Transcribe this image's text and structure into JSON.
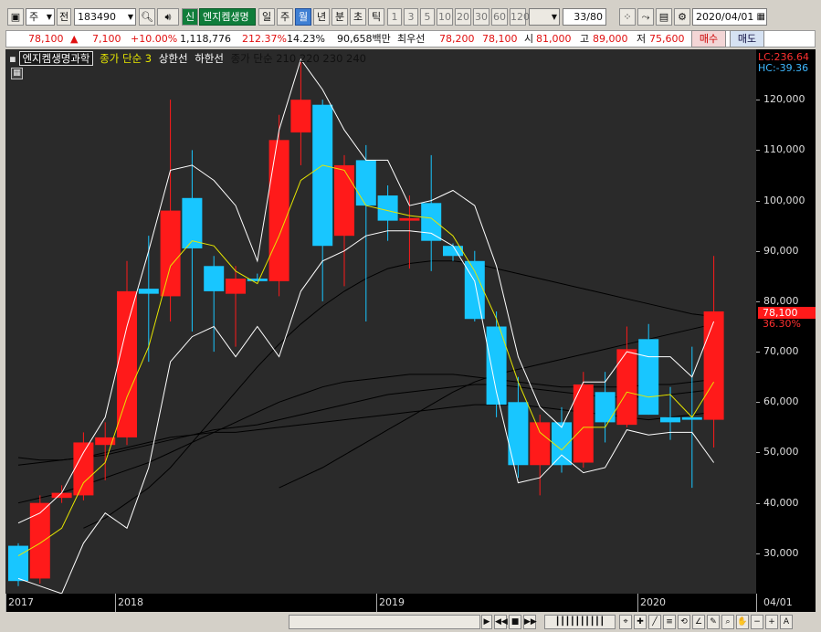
{
  "toolbar": {
    "period_select": "주",
    "prefix_label": "전",
    "code": "183490",
    "market_badge": "신",
    "company": "엔지켐생명",
    "periods": [
      "일",
      "주",
      "월",
      "년"
    ],
    "selected_period": "월",
    "intraday": [
      "분",
      "초",
      "틱"
    ],
    "intervals": [
      "1",
      "3",
      "5",
      "10",
      "20",
      "30",
      "60",
      "120"
    ],
    "counter": "33/80",
    "date": "2020/04/01"
  },
  "quote": {
    "price": "78,100",
    "change": "7,100",
    "change_pct": "+10.00%",
    "volume": "1,118,776",
    "vol_ratio": "212.37%",
    "turnover": "14.23%",
    "amount": "90,658백만",
    "best_label": "최우선",
    "ask": "78,200",
    "bid": "78,100",
    "open_label": "시",
    "open": "81,000",
    "high_label": "고",
    "high": "89,000",
    "low_label": "저",
    "low": "75,600",
    "buy_label": "매수",
    "sell_label": "매도"
  },
  "legend": {
    "name": "엔지켐생명과학",
    "ma_label": "종가 단순 3",
    "upper": "상한선",
    "lower": "하한선",
    "ma_label2": "종가 단순 210  220  230  240"
  },
  "readouts": {
    "lc": "LC:236.64",
    "hc": "HC:-39.36",
    "price_tag": "78,100",
    "pct_tag": "36.30%"
  },
  "colors": {
    "up": "#ff1a1a",
    "down": "#18c6ff",
    "ma": "#e6e600",
    "band": "#ffffff",
    "long_ma": "#000000"
  },
  "chart_data": {
    "type": "candlestick",
    "ylim": [
      22000,
      130000
    ],
    "yticks": [
      "30,000",
      "40,000",
      "50,000",
      "60,000",
      "70,000",
      "80,000",
      "90,000",
      "100,000",
      "110,000",
      "120,000"
    ],
    "x_labels": [
      "2017",
      "2018",
      "2019",
      "2020",
      "04/01"
    ],
    "candles": [
      {
        "o": 31500,
        "h": 32000,
        "l": 23500,
        "c": 24500
      },
      {
        "o": 25000,
        "h": 41500,
        "l": 24000,
        "c": 40000
      },
      {
        "o": 41000,
        "h": 43500,
        "l": 40000,
        "c": 42000
      },
      {
        "o": 41500,
        "h": 54000,
        "l": 40500,
        "c": 52000
      },
      {
        "o": 51500,
        "h": 56000,
        "l": 44500,
        "c": 53000
      },
      {
        "o": 53000,
        "h": 88000,
        "l": 51500,
        "c": 82000
      },
      {
        "o": 82500,
        "h": 93000,
        "l": 68000,
        "c": 81500
      },
      {
        "o": 81000,
        "h": 120000,
        "l": 76000,
        "c": 98000
      },
      {
        "o": 100500,
        "h": 110000,
        "l": 74000,
        "c": 90500
      },
      {
        "o": 87000,
        "h": 89000,
        "l": 70000,
        "c": 82000
      },
      {
        "o": 81500,
        "h": 87000,
        "l": 71000,
        "c": 84500
      },
      {
        "o": 84500,
        "h": 85500,
        "l": 84000,
        "c": 84000
      },
      {
        "o": 84000,
        "h": 117000,
        "l": 81000,
        "c": 112000
      },
      {
        "o": 113500,
        "h": 128000,
        "l": 107000,
        "c": 120000
      },
      {
        "o": 119000,
        "h": 120000,
        "l": 80000,
        "c": 91000
      },
      {
        "o": 93000,
        "h": 109000,
        "l": 83000,
        "c": 107000
      },
      {
        "o": 108000,
        "h": 111000,
        "l": 76000,
        "c": 99000
      },
      {
        "o": 101000,
        "h": 103000,
        "l": 92000,
        "c": 96000
      },
      {
        "o": 96000,
        "h": 101000,
        "l": 86500,
        "c": 96500
      },
      {
        "o": 99500,
        "h": 109000,
        "l": 86000,
        "c": 92000
      },
      {
        "o": 91000,
        "h": 91500,
        "l": 88000,
        "c": 89000
      },
      {
        "o": 88000,
        "h": 90000,
        "l": 76000,
        "c": 76500
      },
      {
        "o": 75000,
        "h": 78000,
        "l": 57000,
        "c": 59500
      },
      {
        "o": 60000,
        "h": 65000,
        "l": 45000,
        "c": 47500
      },
      {
        "o": 47500,
        "h": 57500,
        "l": 41500,
        "c": 56000
      },
      {
        "o": 56000,
        "h": 59000,
        "l": 46000,
        "c": 47500
      },
      {
        "o": 48000,
        "h": 66000,
        "l": 47000,
        "c": 63500
      },
      {
        "o": 62000,
        "h": 66000,
        "l": 52000,
        "c": 56000
      },
      {
        "o": 55500,
        "h": 75000,
        "l": 55000,
        "c": 70500
      },
      {
        "o": 72500,
        "h": 75500,
        "l": 57500,
        "c": 57500
      },
      {
        "o": 57000,
        "h": 63000,
        "l": 52500,
        "c": 56000
      },
      {
        "o": 57000,
        "h": 71000,
        "l": 43000,
        "c": 56500
      },
      {
        "o": 56500,
        "h": 89000,
        "l": 51000,
        "c": 78000
      }
    ],
    "ma3": [
      29500,
      32000,
      35000,
      44000,
      48000,
      61000,
      71000,
      87000,
      92000,
      91000,
      86000,
      83500,
      93000,
      104000,
      107000,
      106000,
      99000,
      98000,
      97000,
      96500,
      93000,
      86000,
      76500,
      64000,
      54000,
      50500,
      55000,
      55000,
      62000,
      61000,
      61500,
      57000,
      64000
    ],
    "band_upper": [
      36000,
      38000,
      42000,
      50000,
      57000,
      75000,
      90000,
      106000,
      107000,
      104000,
      99000,
      88000,
      114000,
      128000,
      122000,
      114000,
      108000,
      108000,
      99000,
      100000,
      102000,
      99000,
      87000,
      69000,
      59000,
      55000,
      64000,
      64000,
      70000,
      69000,
      69000,
      65000,
      76000
    ],
    "band_lower": [
      25000,
      23500,
      22000,
      32000,
      38000,
      35000,
      47000,
      68000,
      73000,
      75000,
      69000,
      75000,
      69000,
      82000,
      88000,
      90000,
      93000,
      94000,
      94000,
      93500,
      91000,
      84000,
      62000,
      44000,
      45000,
      49500,
      46000,
      47000,
      54500,
      53500,
      54000,
      54000,
      48000
    ],
    "long_ma": [
      {
        "start": 0,
        "values": [
          49000,
          48500,
          48500,
          49000,
          50000,
          51000,
          52000,
          53000,
          53500,
          54000,
          54000,
          54500,
          55000,
          55500,
          56000,
          56500,
          57000,
          57500,
          58000,
          58500,
          59000,
          59500,
          59500,
          59500,
          59000,
          58500,
          58000,
          57500,
          57000,
          56500,
          57000,
          57500,
          58000
        ]
      },
      {
        "start": 0,
        "values": [
          47500,
          48000,
          48500,
          49000,
          49500,
          50500,
          51500,
          52500,
          53500,
          54500,
          55000,
          55500,
          56500,
          57500,
          58500,
          59500,
          60500,
          61500,
          62000,
          62500,
          63000,
          63500,
          63500,
          63000,
          62500,
          62000,
          61500,
          61000,
          61000,
          61000,
          61500,
          62000,
          62500
        ]
      },
      {
        "start": 0,
        "values": [
          40000,
          41000,
          42000,
          43500,
          45000,
          46500,
          48000,
          50000,
          52000,
          54000,
          56000,
          58000,
          60000,
          61500,
          63000,
          64000,
          64500,
          65000,
          65500,
          65500,
          65500,
          65000,
          64500,
          64000,
          63500,
          63000,
          63000,
          63000,
          63000,
          63500,
          63500,
          64000,
          64500
        ]
      },
      {
        "start": 3,
        "values": [
          35000,
          37000,
          40000,
          43000,
          47000,
          52000,
          57000,
          62000,
          67000,
          71500,
          75500,
          79000,
          82000,
          84500,
          86500,
          87500,
          88000,
          88000,
          87500,
          86500,
          85500,
          84500,
          83500,
          82500,
          81500,
          80500,
          79500,
          78500,
          77500,
          77000
        ]
      },
      {
        "start": 12,
        "values": [
          43000,
          45000,
          47000,
          49500,
          52000,
          54500,
          57000,
          59500,
          62000,
          64000,
          65500,
          66500,
          67500,
          68500,
          69500,
          70500,
          71500,
          72500,
          73500,
          74500,
          75500
        ]
      }
    ]
  }
}
